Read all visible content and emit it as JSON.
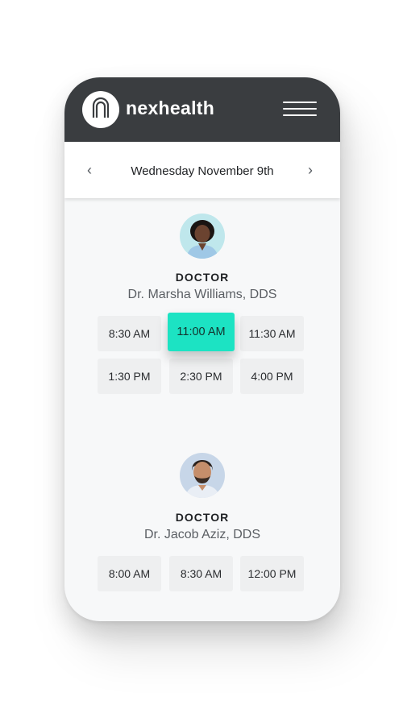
{
  "app": {
    "brand": "nexhealth",
    "icons": {
      "logo": "nexhealth-logo-icon",
      "menu": "hamburger-menu-icon",
      "prev": "chevron-left-icon",
      "next": "chevron-right-icon"
    },
    "colors": {
      "header": "#3a3d40",
      "accent": "#1ce3c3",
      "slot": "#eeeff0"
    }
  },
  "date_bar": {
    "prev_label": "‹",
    "date": "Wednesday November 9th",
    "next_label": "›"
  },
  "doctors": [
    {
      "role": "DOCTOR",
      "name": "Dr. Marsha Williams, DDS",
      "avatar_icon": "doctor-avatar-female",
      "slots": [
        "8:30 AM",
        "11:00 AM",
        "11:30 AM",
        "1:30 PM",
        "2:30 PM",
        "4:00 PM"
      ],
      "selected_slot": "11:00 AM"
    },
    {
      "role": "DOCTOR",
      "name": "Dr. Jacob Aziz, DDS",
      "avatar_icon": "doctor-avatar-male",
      "slots": [
        "8:00 AM",
        "8:30 AM",
        "12:00 PM"
      ]
    }
  ]
}
